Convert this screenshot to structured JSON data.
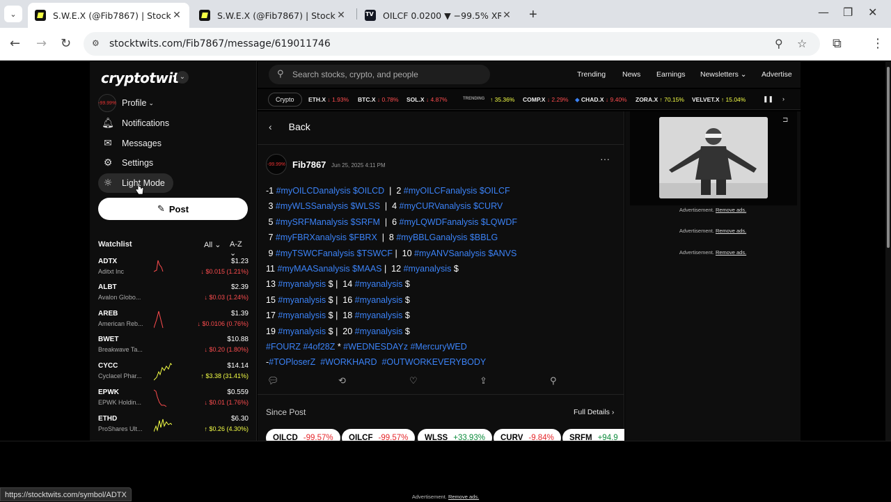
{
  "browser": {
    "tabs": [
      {
        "title": "S.W.E.X (@Fib7867) | Stocktwi",
        "active": true
      },
      {
        "title": "S.W.E.X (@Fib7867) | Stocktwi",
        "active": false
      },
      {
        "title": "OILCF 0.0200 ▼ −99.5% XRP ra",
        "active": false
      }
    ],
    "url": "stocktwits.com/Fib7867/message/619011746",
    "status_url": "https://stocktwits.com/symbol/ADTX"
  },
  "sidebar": {
    "logo": "cryptotwits",
    "avatar_text": "-99.99%",
    "items": [
      {
        "label": "Profile"
      },
      {
        "label": "Notifications"
      },
      {
        "label": "Messages"
      },
      {
        "label": "Settings"
      },
      {
        "label": "Light Mode"
      }
    ],
    "post_label": "Post"
  },
  "watchlist": {
    "title": "Watchlist",
    "filter": "All",
    "sort": "A-Z",
    "rows": [
      {
        "symbol": "ADTX",
        "name": "Aditxt Inc",
        "price": "$1.23",
        "change": "↓ $0.015 (1.21%)",
        "dir": "neg"
      },
      {
        "symbol": "ALBT",
        "name": "Avalon Globo...",
        "price": "$2.39",
        "change": "↓ $0.03 (1.24%)",
        "dir": "neg"
      },
      {
        "symbol": "AREB",
        "name": "American Reb...",
        "price": "$1.39",
        "change": "↓ $0.0106 (0.76%)",
        "dir": "neg"
      },
      {
        "symbol": "BWET",
        "name": "Breakwave Ta...",
        "price": "$10.88",
        "change": "↓ $0.20 (1.80%)",
        "dir": "neg"
      },
      {
        "symbol": "CYCC",
        "name": "Cyclacel Phar...",
        "price": "$14.14",
        "change": "↑ $3.38 (31.41%)",
        "dir": "pos"
      },
      {
        "symbol": "EPWK",
        "name": "EPWK Holdin...",
        "price": "$0.559",
        "change": "↓ $0.01 (1.76%)",
        "dir": "neg"
      },
      {
        "symbol": "ETHD",
        "name": "ProShares Ult...",
        "price": "$6.30",
        "change": "↑ $0.26 (4.30%)",
        "dir": "pos"
      }
    ]
  },
  "topbar": {
    "search_placeholder": "Search stocks, crypto, and people",
    "nav": [
      "Trending",
      "News",
      "Earnings",
      "Newsletters",
      "Advertise"
    ]
  },
  "ticker": {
    "pill": "Crypto",
    "items": [
      {
        "sym": "ETH.X",
        "chg": "↓ 1.93%",
        "dir": "neg"
      },
      {
        "sym": "BTC.X",
        "chg": "↓ 0.78%",
        "dir": "neg"
      },
      {
        "sym": "SOL.X",
        "chg": "↓ 4.87%",
        "dir": "neg"
      }
    ],
    "trending_label": "TRENDING",
    "trending": [
      {
        "sym": "",
        "chg": "↑ 35.36%",
        "dir": "pos"
      },
      {
        "sym": "COMP.X",
        "chg": "↓ 2.29%",
        "dir": "neg"
      },
      {
        "sym": "CHAD.X",
        "chg": "↓ 9.40%",
        "dir": "neg"
      },
      {
        "sym": "ZORA.X",
        "chg": "↑ 70.15%",
        "dir": "pos"
      },
      {
        "sym": "VELVET.X",
        "chg": "↑ 15.04%",
        "dir": "pos"
      }
    ]
  },
  "post": {
    "back_label": "Back",
    "avatar_text": "-99.99%",
    "author": "Fib7867",
    "date": "Jun 25, 2025 4:11 PM",
    "lines": [
      [
        {
          "t": "-1 "
        },
        {
          "t": "#myOILCDanalysis $OILCD",
          "l": 1
        },
        {
          "t": "  |  2 "
        },
        {
          "t": "#myOILCFanalysis $OILCF",
          "l": 1
        }
      ],
      [
        {
          "t": " 3 "
        },
        {
          "t": "#myWLSSanalysis $WLSS",
          "l": 1
        },
        {
          "t": "  |  4 "
        },
        {
          "t": "#myCURVanalysis $CURV",
          "l": 1
        }
      ],
      [
        {
          "t": " 5 "
        },
        {
          "t": "#mySRFManalysis $SRFM",
          "l": 1
        },
        {
          "t": "  |  6 "
        },
        {
          "t": "#myLQWDFanalysis $LQWDF",
          "l": 1
        }
      ],
      [
        {
          "t": " 7 "
        },
        {
          "t": "#myFBRXanalysis $FBRX",
          "l": 1
        },
        {
          "t": "  |  8 "
        },
        {
          "t": "#myBBLGanalysis $BBLG",
          "l": 1
        }
      ],
      [
        {
          "t": " 9 "
        },
        {
          "t": "#myTSWCFanalysis $TSWCF",
          "l": 1
        },
        {
          "t": " |  10 "
        },
        {
          "t": "#myANVSanalysis $ANVS",
          "l": 1
        }
      ],
      [
        {
          "t": "11 "
        },
        {
          "t": "#myMAASanalysis $MAAS",
          "l": 1
        },
        {
          "t": " |  12 "
        },
        {
          "t": "#myanalysis",
          "l": 1
        },
        {
          "t": " $"
        }
      ],
      [
        {
          "t": "13 "
        },
        {
          "t": "#myanalysis",
          "l": 1
        },
        {
          "t": " $ |  14 "
        },
        {
          "t": "#myanalysis",
          "l": 1
        },
        {
          "t": " $"
        }
      ],
      [
        {
          "t": "15 "
        },
        {
          "t": "#myanalysis",
          "l": 1
        },
        {
          "t": " $ |  16 "
        },
        {
          "t": "#myanalysis",
          "l": 1
        },
        {
          "t": " $"
        }
      ],
      [
        {
          "t": "17 "
        },
        {
          "t": "#myanalysis",
          "l": 1
        },
        {
          "t": " $ |  18 "
        },
        {
          "t": "#myanalysis",
          "l": 1
        },
        {
          "t": " $"
        }
      ],
      [
        {
          "t": "19 "
        },
        {
          "t": "#myanalysis",
          "l": 1
        },
        {
          "t": " $ |  20 "
        },
        {
          "t": "#myanalysis",
          "l": 1
        },
        {
          "t": " $"
        }
      ],
      [
        {
          "t": "#FOURZ #4of28Z",
          "l": 1
        },
        {
          "t": " * "
        },
        {
          "t": "#WEDNESDAYz #MercuryWED",
          "l": 1
        }
      ],
      [
        {
          "t": "-"
        },
        {
          "t": "#TOPloserZ  #WORKHARD  #OUTWORKEVERYBODY",
          "l": 1
        }
      ]
    ],
    "since_label": "Since Post",
    "full_details": "Full Details",
    "chips": [
      {
        "sym": "OILCD",
        "chg": "-99.57%",
        "dir": "neg"
      },
      {
        "sym": "OILCF",
        "chg": "-99.57%",
        "dir": "neg"
      },
      {
        "sym": "WLSS",
        "chg": "+33.93%",
        "dir": "pos"
      },
      {
        "sym": "CURV",
        "chg": "-9.84%",
        "dir": "neg"
      },
      {
        "sym": "SRFM",
        "chg": "+94.9",
        "dir": "pos"
      }
    ]
  },
  "ads": {
    "text": "Advertisement.",
    "remove": "Remove ads."
  }
}
